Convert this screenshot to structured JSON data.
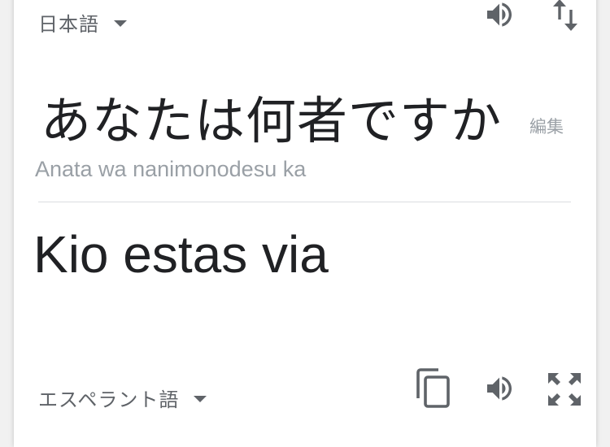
{
  "source": {
    "language": "日本語",
    "text": "あなたは何者ですか",
    "edit_label": "編集",
    "romanization": "Anata wa nanimonodesu ka"
  },
  "target": {
    "language": "エスペラント語",
    "text": "Kio estas via"
  },
  "icons": {
    "source_speaker": "speaker-icon",
    "swap": "swap-languages-icon",
    "copy": "copy-icon",
    "target_speaker": "speaker-icon",
    "fullscreen": "fullscreen-icon",
    "dropdown": "caret-down-icon"
  },
  "colors": {
    "text_primary": "#202124",
    "text_secondary": "#5f6368",
    "text_muted": "#9aa0a6",
    "divider": "#dadce0"
  }
}
